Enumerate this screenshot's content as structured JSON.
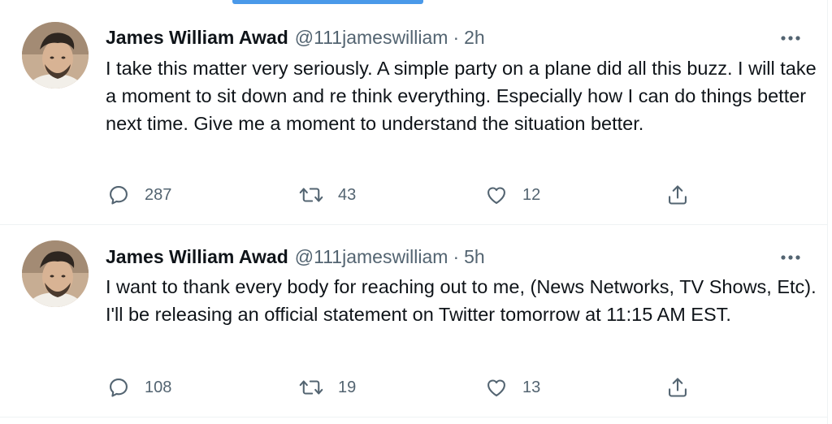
{
  "tweets": [
    {
      "author_name": "James William Awad",
      "handle": "@111jameswilliam",
      "separator": "·",
      "time": "2h",
      "text": "I take this matter very seriously. A simple party on a plane did all this buzz. I will take a moment to sit down and re think everything. Especially how I can do things better next time. Give me a moment to understand the situation better.",
      "replies": "287",
      "retweets": "43",
      "likes": "12"
    },
    {
      "author_name": "James William Awad",
      "handle": "@111jameswilliam",
      "separator": "·",
      "time": "5h",
      "text": "I want to thank every body for reaching out to me, (News Networks, TV Shows, Etc). I'll be releasing an official statement on Twitter tomorrow at 11:15 AM EST.",
      "replies": "108",
      "retweets": "19",
      "likes": "13"
    }
  ],
  "icons": {
    "more": "more-horizontal-icon",
    "reply": "reply-bubble-icon",
    "retweet": "retweet-arrows-icon",
    "like": "heart-icon",
    "share": "share-upload-icon"
  },
  "colors": {
    "text_primary": "#0f1419",
    "text_secondary": "#536471",
    "divider": "#eff3f4",
    "accent": "#4a99e9"
  }
}
